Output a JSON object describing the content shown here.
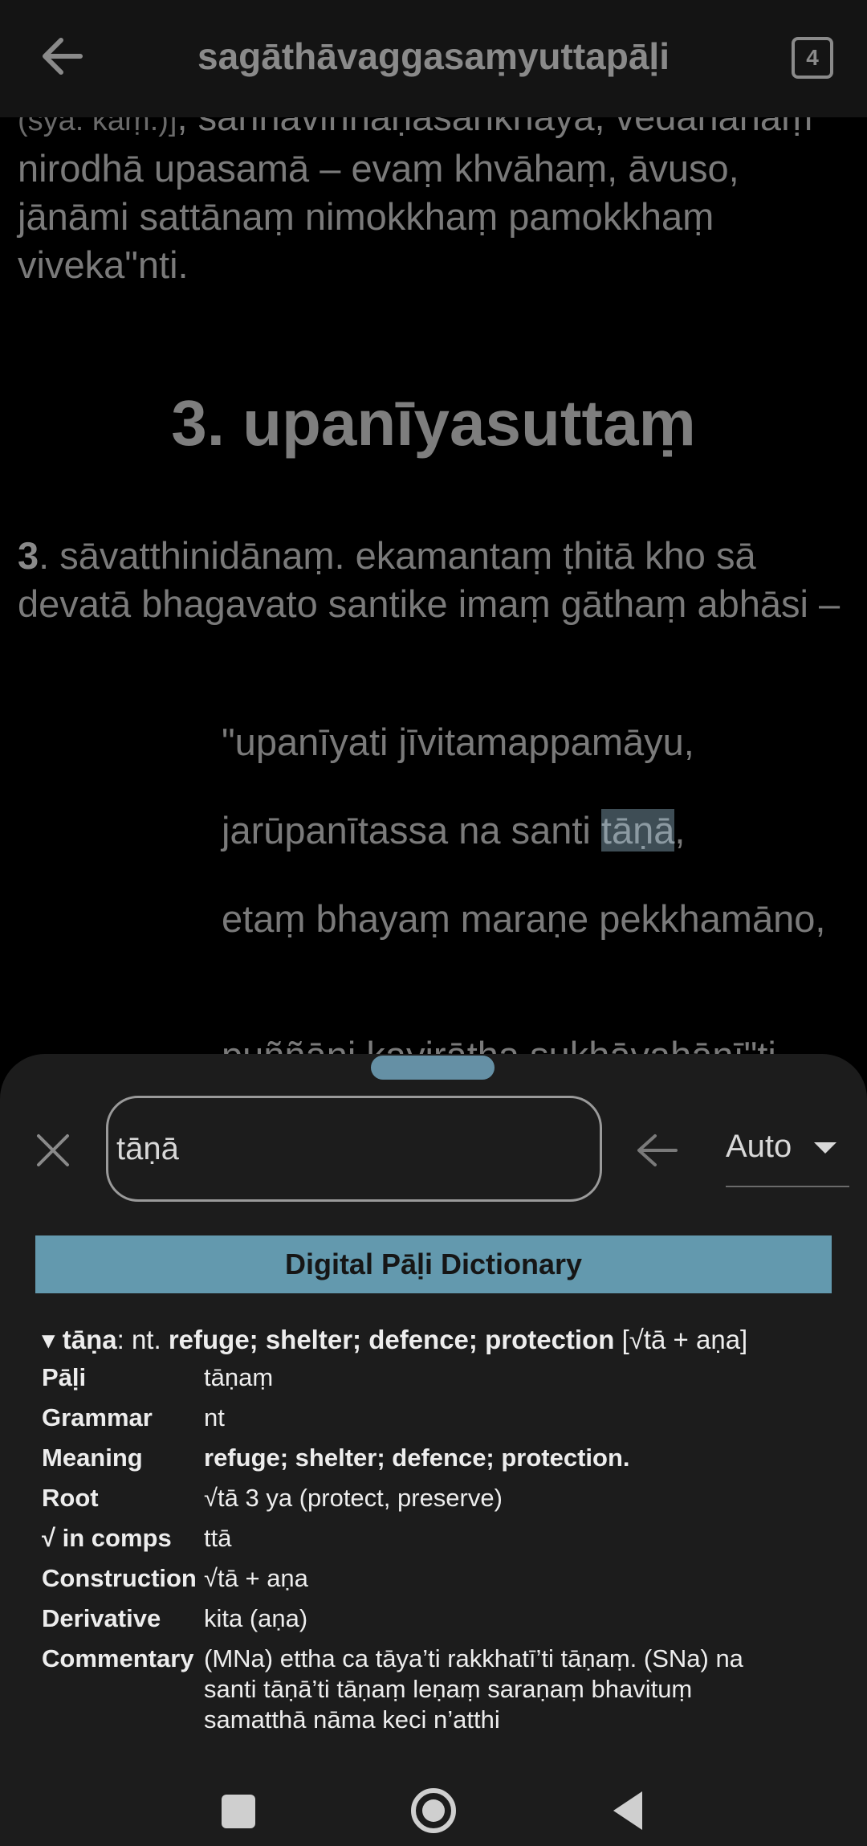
{
  "appbar": {
    "title": "sagāthāvaggasaṃyuttapāḷi",
    "tabs_count": "4"
  },
  "content": {
    "para1_small": "(syā. kaṃ.)]",
    "para1_rest": ", saññāviññāṇasaṅkhayā, vedanānaṃ nirodhā upasamā – evaṃ khvāhaṃ, āvuso, jānāmi sattānaṃ nimokkhaṃ pamokkhaṃ viveka\"nti.",
    "heading": "3. upanīyasuttaṃ",
    "para2_num": "3",
    "para2_rest": ". sāvatthinidānaṃ. ekamantaṃ ṭhitā kho sā devatā bhagavato santike imaṃ gāthaṃ abhāsi –",
    "verse1": "\"upanīyati jīvitamappamāyu,",
    "verse2_pre": "jarūpanītassa na santi ",
    "verse2_hl": "tāṇā",
    "verse2_post": ",",
    "verse3": "etaṃ bhayaṃ maraṇe pekkhamāno,",
    "verse4": "puññāni kayirātha sukhāvahānī\"ti."
  },
  "sheet": {
    "search_value": "tāṇā",
    "language": "Auto",
    "dictionary_title": "Digital Pāḷi Dictionary",
    "entry": {
      "toggle": "▾",
      "headword": "tāṇa",
      "head_pos": ": nt. ",
      "head_meaning": "refuge; shelter; defence; protection",
      "head_construction": " [√tā + aṇa]",
      "rows": [
        {
          "label": "Pāḷi",
          "value": "tāṇaṃ"
        },
        {
          "label": "Grammar",
          "value": "nt"
        },
        {
          "label": "Meaning",
          "value": "refuge; shelter; defence; protection."
        },
        {
          "label": "Root",
          "value": "√tā 3 ya (protect, preserve)"
        },
        {
          "label": "√ in comps",
          "value": "ttā"
        },
        {
          "label": "Construction",
          "value": "√tā + aṇa"
        },
        {
          "label": "Derivative",
          "value": "kita (aṇa)"
        },
        {
          "label": "Commentary",
          "value": "(MNa) ettha ca tāya’ti rakkhatī’ti tāṇaṃ. (SNa) na santi tāṇā’ti tāṇaṃ leṇaṃ saraṇaṃ bhavituṃ samatthā nāma keci n’atthi"
        }
      ]
    }
  },
  "colors": {
    "background": "#000000",
    "sheet": "#1c1c1c",
    "accent": "#6399ae",
    "highlight": "#3e4d55"
  }
}
